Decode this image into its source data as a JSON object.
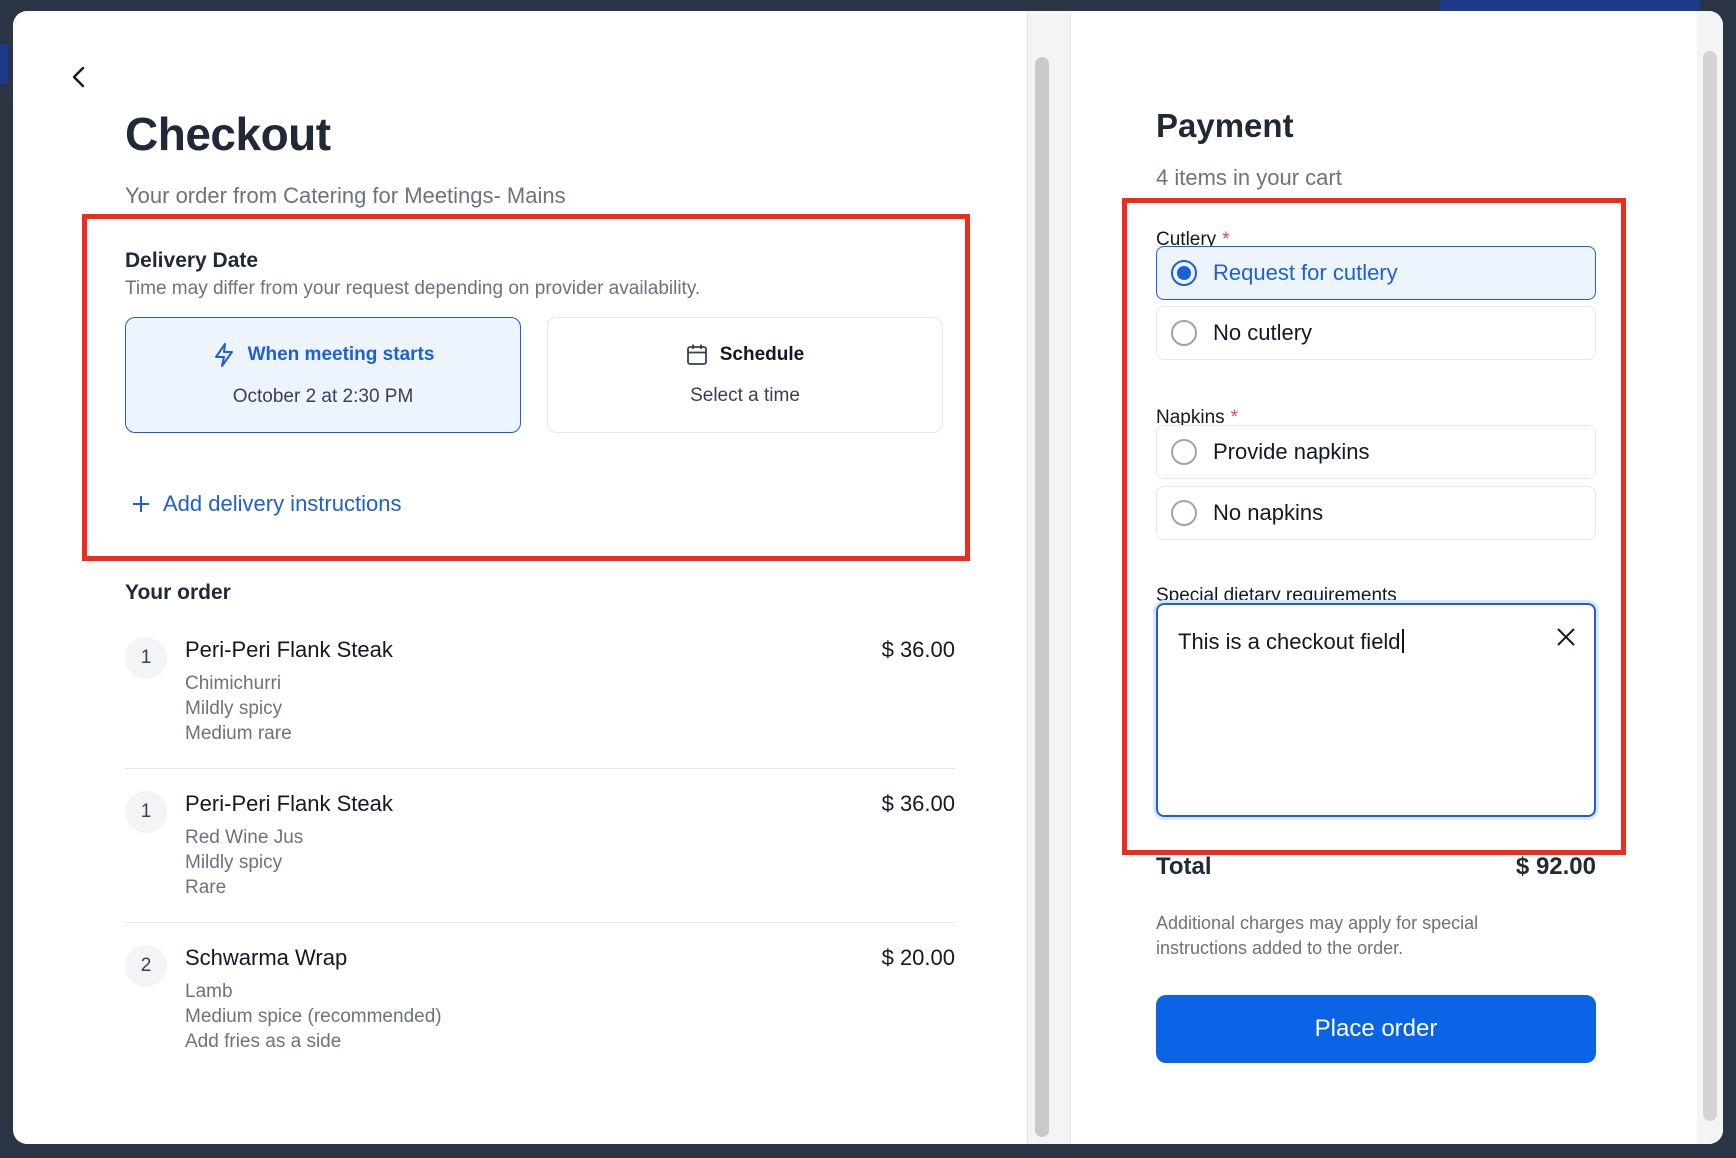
{
  "checkout": {
    "title": "Checkout",
    "subtitle": "Your order from Catering for Meetings- Mains"
  },
  "delivery": {
    "heading": "Delivery Date",
    "sub": "Time may differ from your request depending on provider availability.",
    "options": [
      {
        "label": "When meeting starts",
        "sub": "October 2 at 2:30 PM",
        "icon": "lightning-icon",
        "selected": true
      },
      {
        "label": "Schedule",
        "sub": "Select a time",
        "icon": "calendar-icon",
        "selected": false
      }
    ],
    "add_instructions": "Add delivery instructions"
  },
  "order": {
    "heading": "Your order",
    "items": [
      {
        "qty": "1",
        "name": "Peri-Peri Flank Steak",
        "price": "$ 36.00",
        "mods": [
          "Chimichurri",
          "Mildly spicy",
          "Medium rare"
        ]
      },
      {
        "qty": "1",
        "name": "Peri-Peri Flank Steak",
        "price": "$ 36.00",
        "mods": [
          "Red Wine Jus",
          "Mildly spicy",
          "Rare"
        ]
      },
      {
        "qty": "2",
        "name": "Schwarma Wrap",
        "price": "$ 20.00",
        "mods": [
          "Lamb",
          "Medium spice (recommended)",
          "Add fries as a side"
        ]
      }
    ]
  },
  "payment": {
    "title": "Payment",
    "sub": "4 items in your cart",
    "cutlery": {
      "label": "Cutlery",
      "required": "*",
      "options": [
        "Request for cutlery",
        "No cutlery"
      ],
      "selected": "Request for cutlery"
    },
    "napkins": {
      "label": "Napkins",
      "required": "*",
      "options": [
        "Provide napkins",
        "No napkins"
      ],
      "selected": null
    },
    "dietary": {
      "label": "Special dietary requirements",
      "value": "This is a checkout field"
    },
    "total_label": "Total",
    "total_value": "$ 92.00",
    "note": "Additional charges may apply for special instructions added to the order.",
    "place_order": "Place order"
  },
  "colors": {
    "accent": "#0b63e5",
    "highlight": "#ef2b1d"
  }
}
